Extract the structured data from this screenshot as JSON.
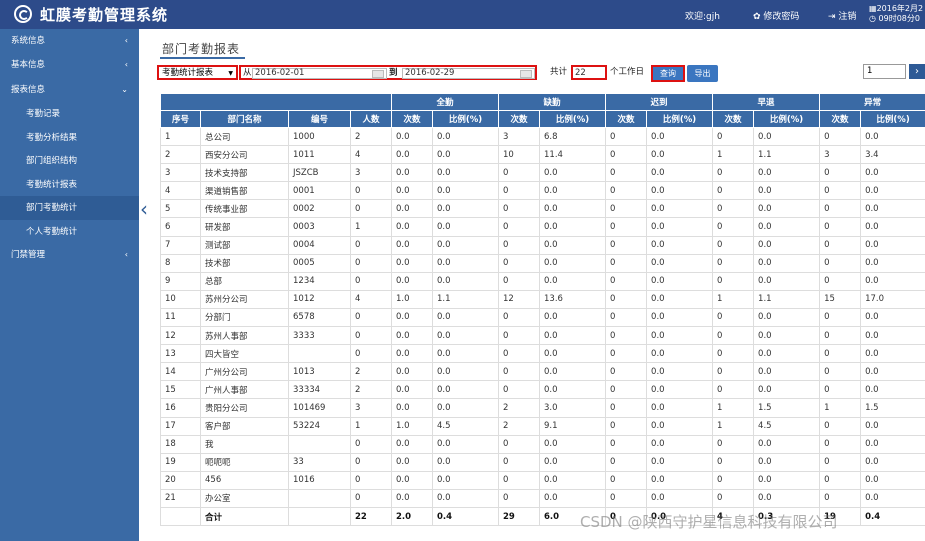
{
  "header": {
    "app_title": "虹膜考勤管理系统",
    "welcome": "欢迎:gjh",
    "change_password": "修改密码",
    "logout": "注销",
    "date_line1": "2016年2月2",
    "date_line2": "09时08分0"
  },
  "sidebar": {
    "items": [
      {
        "label": "系统信息",
        "chevron": "‹"
      },
      {
        "label": "基本信息",
        "chevron": "‹"
      },
      {
        "label": "报表信息",
        "chevron": "⌄"
      },
      {
        "label": "考勤记录"
      },
      {
        "label": "考勤分析结果"
      },
      {
        "label": "部门组织结构"
      },
      {
        "label": "考勤统计报表"
      },
      {
        "label": "部门考勤统计"
      },
      {
        "label": "个人考勤统计"
      },
      {
        "label": "门禁管理",
        "chevron": "‹"
      }
    ]
  },
  "main": {
    "title": "部门考勤报表",
    "report_select": "考勤统计报表",
    "from_label": "从",
    "date_from": "2016-02-01",
    "to_label": "到",
    "date_to": "2016-02-29",
    "total_label": "共计",
    "workdays": "22",
    "workdays_suffix": "个工作日",
    "query_button": "查询",
    "export_button": "导出",
    "page_number": "1",
    "next_icon": "›"
  },
  "table": {
    "group_headers": [
      "全勤",
      "缺勤",
      "迟到",
      "早退",
      "异常"
    ],
    "sub_headers": [
      "序号",
      "部门名称",
      "编号",
      "人数",
      "次数",
      "比例(%)",
      "次数",
      "比例(%)",
      "次数",
      "比例(%)",
      "次数",
      "比例(%)",
      "次数",
      "比例(%)"
    ],
    "rows": [
      [
        "1",
        "总公司",
        "1000",
        "2",
        "0.0",
        "0.0",
        "3",
        "6.8",
        "0",
        "0.0",
        "0",
        "0.0",
        "0",
        "0.0"
      ],
      [
        "2",
        "西安分公司",
        "1011",
        "4",
        "0.0",
        "0.0",
        "10",
        "11.4",
        "0",
        "0.0",
        "1",
        "1.1",
        "3",
        "3.4"
      ],
      [
        "3",
        "技术支持部",
        "JSZCB",
        "3",
        "0.0",
        "0.0",
        "0",
        "0.0",
        "0",
        "0.0",
        "0",
        "0.0",
        "0",
        "0.0"
      ],
      [
        "4",
        "渠道销售部",
        "0001",
        "0",
        "0.0",
        "0.0",
        "0",
        "0.0",
        "0",
        "0.0",
        "0",
        "0.0",
        "0",
        "0.0"
      ],
      [
        "5",
        "传统事业部",
        "0002",
        "0",
        "0.0",
        "0.0",
        "0",
        "0.0",
        "0",
        "0.0",
        "0",
        "0.0",
        "0",
        "0.0"
      ],
      [
        "6",
        "研发部",
        "0003",
        "1",
        "0.0",
        "0.0",
        "0",
        "0.0",
        "0",
        "0.0",
        "0",
        "0.0",
        "0",
        "0.0"
      ],
      [
        "7",
        "测试部",
        "0004",
        "0",
        "0.0",
        "0.0",
        "0",
        "0.0",
        "0",
        "0.0",
        "0",
        "0.0",
        "0",
        "0.0"
      ],
      [
        "8",
        "技术部",
        "0005",
        "0",
        "0.0",
        "0.0",
        "0",
        "0.0",
        "0",
        "0.0",
        "0",
        "0.0",
        "0",
        "0.0"
      ],
      [
        "9",
        "总部",
        "1234",
        "0",
        "0.0",
        "0.0",
        "0",
        "0.0",
        "0",
        "0.0",
        "0",
        "0.0",
        "0",
        "0.0"
      ],
      [
        "10",
        "苏州分公司",
        "1012",
        "4",
        "1.0",
        "1.1",
        "12",
        "13.6",
        "0",
        "0.0",
        "1",
        "1.1",
        "15",
        "17.0"
      ],
      [
        "11",
        "分部门",
        "6578",
        "0",
        "0.0",
        "0.0",
        "0",
        "0.0",
        "0",
        "0.0",
        "0",
        "0.0",
        "0",
        "0.0"
      ],
      [
        "12",
        "苏州人事部",
        "3333",
        "0",
        "0.0",
        "0.0",
        "0",
        "0.0",
        "0",
        "0.0",
        "0",
        "0.0",
        "0",
        "0.0"
      ],
      [
        "13",
        "四大皆空",
        "",
        "0",
        "0.0",
        "0.0",
        "0",
        "0.0",
        "0",
        "0.0",
        "0",
        "0.0",
        "0",
        "0.0"
      ],
      [
        "14",
        "广州分公司",
        "1013",
        "2",
        "0.0",
        "0.0",
        "0",
        "0.0",
        "0",
        "0.0",
        "0",
        "0.0",
        "0",
        "0.0"
      ],
      [
        "15",
        "广州人事部",
        "33334",
        "2",
        "0.0",
        "0.0",
        "0",
        "0.0",
        "0",
        "0.0",
        "0",
        "0.0",
        "0",
        "0.0"
      ],
      [
        "16",
        "贵阳分公司",
        "101469",
        "3",
        "0.0",
        "0.0",
        "2",
        "3.0",
        "0",
        "0.0",
        "1",
        "1.5",
        "1",
        "1.5"
      ],
      [
        "17",
        "客户部",
        "53224",
        "1",
        "1.0",
        "4.5",
        "2",
        "9.1",
        "0",
        "0.0",
        "1",
        "4.5",
        "0",
        "0.0"
      ],
      [
        "18",
        "我",
        "",
        "0",
        "0.0",
        "0.0",
        "0",
        "0.0",
        "0",
        "0.0",
        "0",
        "0.0",
        "0",
        "0.0"
      ],
      [
        "19",
        "呃呃呃",
        "33",
        "0",
        "0.0",
        "0.0",
        "0",
        "0.0",
        "0",
        "0.0",
        "0",
        "0.0",
        "0",
        "0.0"
      ],
      [
        "20",
        "456",
        "1016",
        "0",
        "0.0",
        "0.0",
        "0",
        "0.0",
        "0",
        "0.0",
        "0",
        "0.0",
        "0",
        "0.0"
      ],
      [
        "21",
        "办公室",
        "",
        "0",
        "0.0",
        "0.0",
        "0",
        "0.0",
        "0",
        "0.0",
        "0",
        "0.0",
        "0",
        "0.0"
      ]
    ],
    "total_row": [
      "",
      "合计",
      "",
      "22",
      "2.0",
      "0.4",
      "29",
      "6.0",
      "0",
      "0.0",
      "4",
      "0.3",
      "19",
      "0.4"
    ]
  },
  "watermark": "CSDN @陕西守护星信息科技有限公司"
}
